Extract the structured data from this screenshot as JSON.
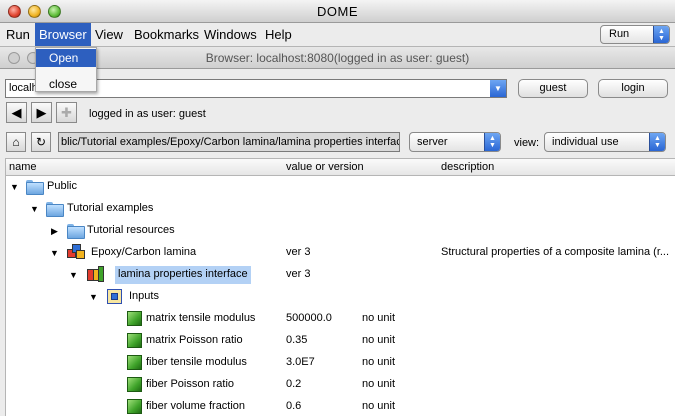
{
  "window": {
    "title": "DOME"
  },
  "menu": {
    "items": [
      {
        "label": "Run",
        "active": false
      },
      {
        "label": "Browser",
        "active": true
      },
      {
        "label": "View",
        "active": false
      },
      {
        "label": "Bookmarks",
        "active": false
      },
      {
        "label": "Windows",
        "active": false
      },
      {
        "label": "Help",
        "active": false
      }
    ],
    "run_select": "Run"
  },
  "browser_menu": {
    "items": [
      "Open",
      "close"
    ],
    "highlighted": "Open"
  },
  "inner_window": {
    "title": "Browser: localhost:8080(logged in as user: guest)"
  },
  "url_row": {
    "url_value": "localh",
    "user_button": "guest",
    "login_button": "login"
  },
  "nav_row": {
    "status": "logged in as user: guest"
  },
  "path_row": {
    "path": "blic/Tutorial examples/Epoxy/Carbon lamina/lamina properties interfac",
    "location_select": "server",
    "view_label": "view:",
    "view_select": "individual use"
  },
  "table": {
    "headers": {
      "name": "name",
      "value": "value or version",
      "description": "description"
    },
    "rows": [
      {
        "name": "Public",
        "value": "",
        "unit": "",
        "description": "",
        "icon": "folder-icon",
        "expanded": true
      },
      {
        "name": "Tutorial examples",
        "value": "",
        "unit": "",
        "description": "",
        "icon": "folder-icon",
        "expanded": true
      },
      {
        "name": "Tutorial resources",
        "value": "",
        "unit": "",
        "description": "",
        "icon": "folder-icon",
        "expanded": false
      },
      {
        "name": "Epoxy/Carbon lamina",
        "value": "ver 3",
        "unit": "",
        "description": "Structural properties of a composite lamina (r...",
        "icon": "model-icon",
        "expanded": true
      },
      {
        "name": "lamina properties interface",
        "value": "ver 3",
        "unit": "",
        "description": "",
        "icon": "interface-icon",
        "expanded": true,
        "selected": true
      },
      {
        "name": "Inputs",
        "value": "",
        "unit": "",
        "description": "",
        "icon": "filter-icon",
        "expanded": true
      },
      {
        "name": "matrix tensile modulus",
        "value": "500000.0",
        "unit": "no unit",
        "description": "",
        "icon": "parameter-cube-icon"
      },
      {
        "name": "matrix Poisson ratio",
        "value": "0.35",
        "unit": "no unit",
        "description": "",
        "icon": "parameter-cube-icon"
      },
      {
        "name": "fiber tensile modulus",
        "value": "3.0E7",
        "unit": "no unit",
        "description": "",
        "icon": "parameter-cube-icon"
      },
      {
        "name": "fiber Poisson ratio",
        "value": "0.2",
        "unit": "no unit",
        "description": "",
        "icon": "parameter-cube-icon"
      },
      {
        "name": "fiber volume fraction",
        "value": "0.6",
        "unit": "no unit",
        "description": "",
        "icon": "parameter-cube-icon"
      }
    ]
  }
}
